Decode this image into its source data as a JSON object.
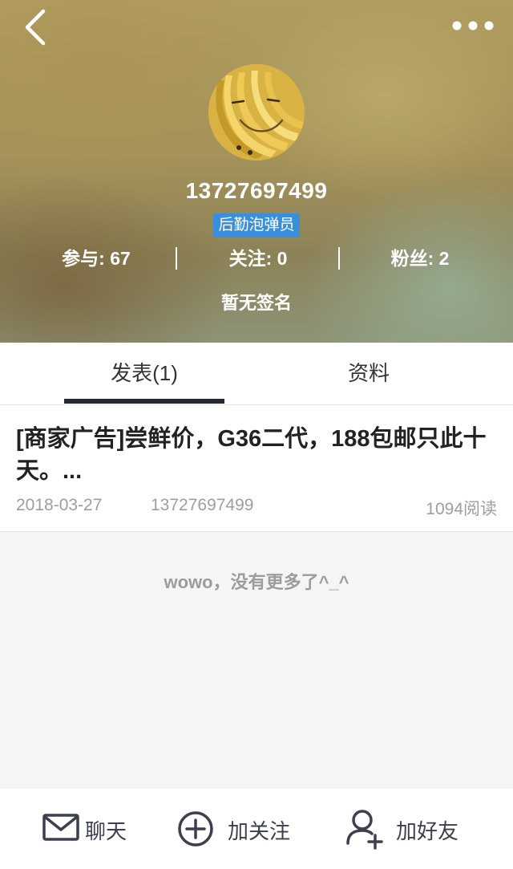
{
  "header": {
    "username": "13727697499",
    "badge": "后勤泡弹员",
    "stats": {
      "participate": "参与: 67",
      "following": "关注: 0",
      "fans": "粉丝: 2"
    },
    "signature": "暂无签名",
    "icons": {
      "back": "chevron-left-icon",
      "more": "more-dots-icon",
      "avatar": "banana-avatar"
    }
  },
  "tabs": [
    {
      "label": "发表(1)",
      "active": true
    },
    {
      "label": "资料",
      "active": false
    }
  ],
  "posts": [
    {
      "title": "[商家广告]尝鲜价，G36二代，188包邮只此十天。...",
      "date": "2018-03-27",
      "author": "13727697499",
      "reads": "1094阅读"
    }
  ],
  "list_end_text": "wowo，没有更多了^_^",
  "bottom_bar": {
    "chat": "聊天",
    "follow": "加关注",
    "add_friend": "加好友"
  },
  "colors": {
    "badge": "#3a8fdc",
    "tab_indicator": "#222836",
    "icon": "#3c3f4e"
  }
}
